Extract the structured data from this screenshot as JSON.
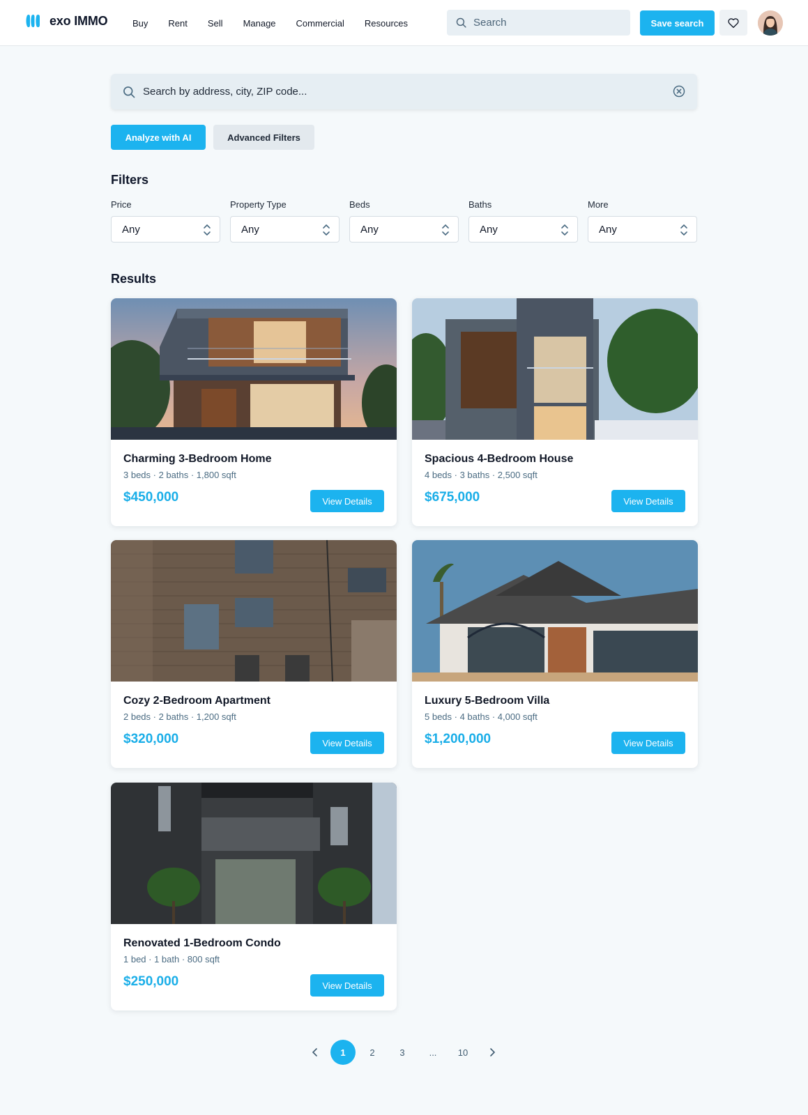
{
  "header": {
    "brand": "exo IMMO",
    "nav": [
      "Buy",
      "Rent",
      "Sell",
      "Manage",
      "Commercial",
      "Resources"
    ],
    "search_placeholder": "Search",
    "save_search_label": "Save search"
  },
  "search": {
    "placeholder": "Search by address, city, ZIP code..."
  },
  "actions": {
    "analyze_label": "Analyze with AI",
    "advanced_label": "Advanced Filters"
  },
  "filters": {
    "title": "Filters",
    "items": [
      {
        "label": "Price",
        "value": "Any"
      },
      {
        "label": "Property Type",
        "value": "Any"
      },
      {
        "label": "Beds",
        "value": "Any"
      },
      {
        "label": "Baths",
        "value": "Any"
      },
      {
        "label": "More",
        "value": "Any"
      }
    ]
  },
  "results": {
    "title": "Results",
    "button_label": "View Details",
    "listings": [
      {
        "title": "Charming 3-Bedroom Home",
        "meta": "3 beds · 2 baths · 1,800 sqft",
        "price": "$450,000"
      },
      {
        "title": "Spacious 4-Bedroom House",
        "meta": "4 beds · 3 baths · 2,500 sqft",
        "price": "$675,000"
      },
      {
        "title": "Cozy 2-Bedroom Apartment",
        "meta": "2 beds · 2 baths · 1,200 sqft",
        "price": "$320,000"
      },
      {
        "title": "Luxury 5-Bedroom Villa",
        "meta": "5 beds · 4 baths · 4,000 sqft",
        "price": "$1,200,000"
      },
      {
        "title": "Renovated 1-Bedroom Condo",
        "meta": "1 bed · 1 bath · 800 sqft",
        "price": "$250,000"
      }
    ]
  },
  "pagination": {
    "pages": [
      "1",
      "2",
      "3",
      "...",
      "10"
    ],
    "current": "1"
  },
  "colors": {
    "accent": "#1cb3ef",
    "price": "#1aaee8",
    "meta": "#4a6b82",
    "background": "#f5f9fb"
  }
}
